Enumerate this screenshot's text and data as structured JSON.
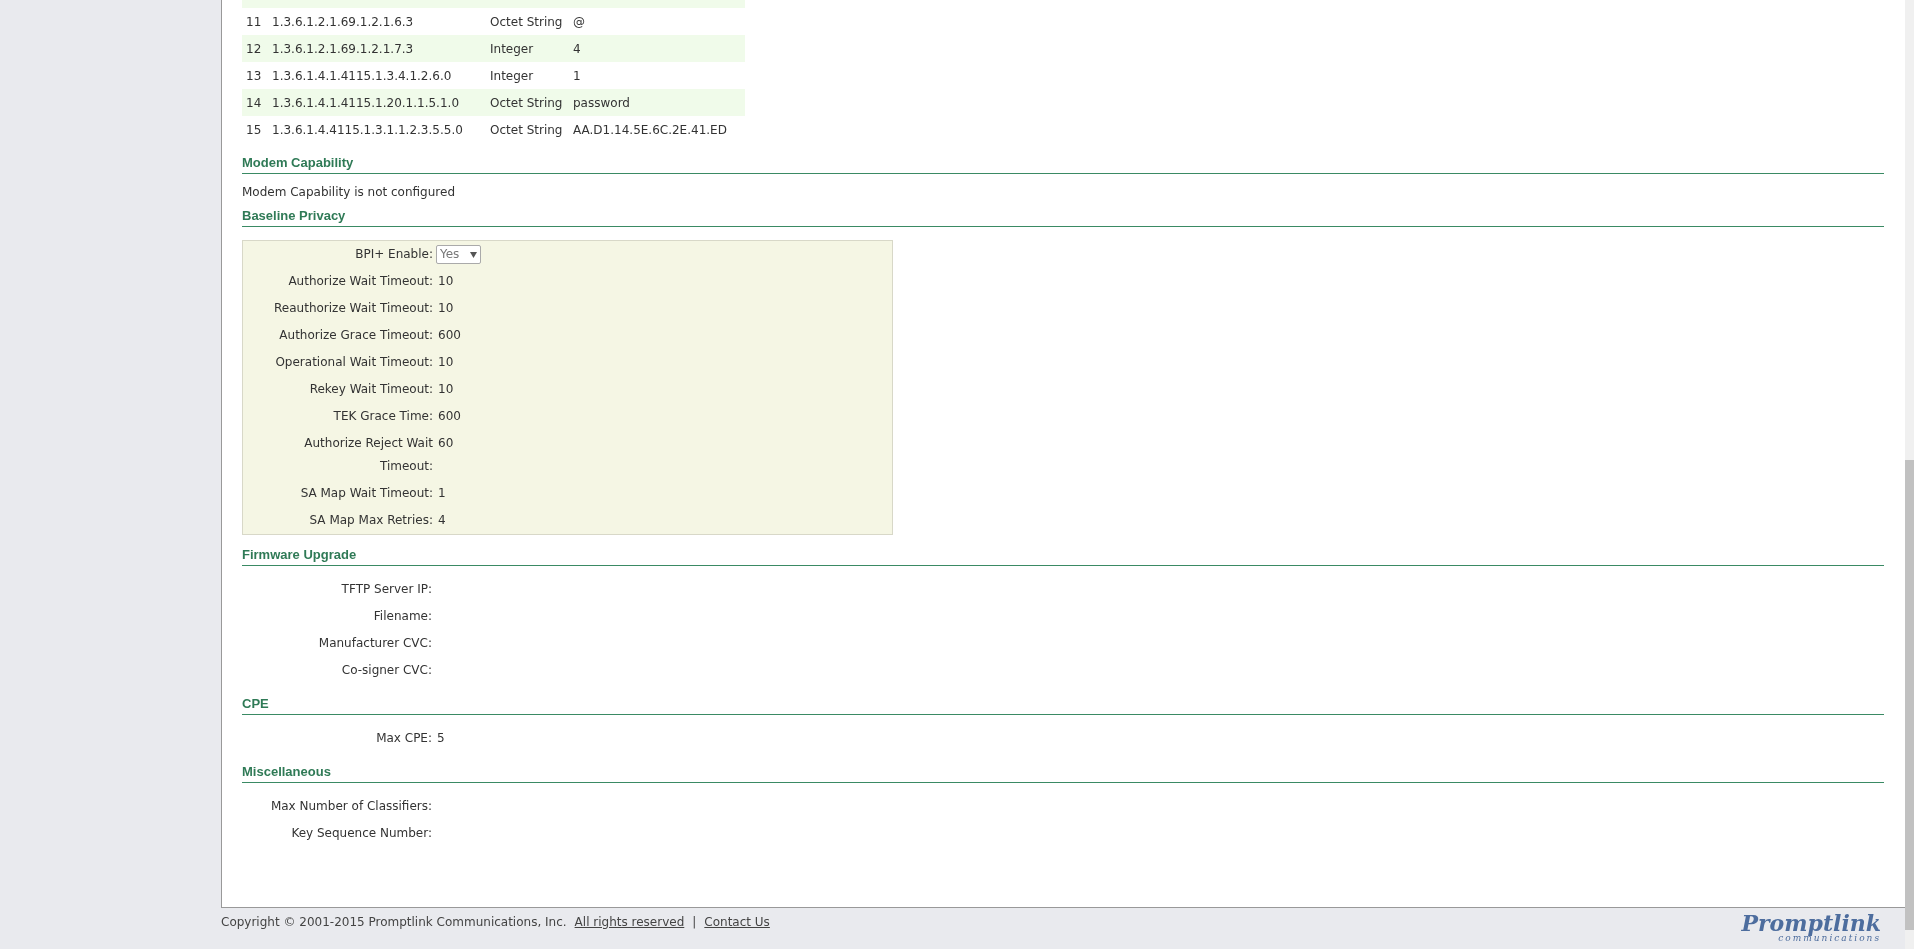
{
  "snmp_table": {
    "rows": [
      {
        "index": "11",
        "oid": "1.3.6.1.2.1.69.1.2.1.6.3",
        "type": "Octet String",
        "value": "@"
      },
      {
        "index": "12",
        "oid": "1.3.6.1.2.1.69.1.2.1.7.3",
        "type": "Integer",
        "value": "4"
      },
      {
        "index": "13",
        "oid": "1.3.6.1.4.1.4115.1.3.4.1.2.6.0",
        "type": "Integer",
        "value": "1"
      },
      {
        "index": "14",
        "oid": "1.3.6.1.4.1.4115.1.20.1.1.5.1.0",
        "type": "Octet String",
        "value": "password"
      },
      {
        "index": "15",
        "oid": "1.3.6.1.4.4115.1.3.1.1.2.3.5.5.0",
        "type": "Octet String",
        "value": "AA.D1.14.5E.6C.2E.41.ED"
      }
    ]
  },
  "sections": [
    {
      "kind": "note",
      "title": "Modem Capability",
      "text": "Modem Capability is not configured"
    },
    {
      "kind": "boxed_form",
      "title": "Baseline Privacy",
      "fields": [
        {
          "kind": "select",
          "label": "BPI+ Enable:",
          "value": "Yes"
        },
        {
          "kind": "text",
          "label": "Authorize Wait Timeout:",
          "value": "10"
        },
        {
          "kind": "text",
          "label": "Reauthorize Wait Timeout:",
          "value": "10"
        },
        {
          "kind": "text",
          "label": "Authorize Grace Timeout:",
          "value": "600"
        },
        {
          "kind": "text",
          "label": "Operational Wait Timeout:",
          "value": "10"
        },
        {
          "kind": "text",
          "label": "Rekey Wait Timeout:",
          "value": "10"
        },
        {
          "kind": "text",
          "label": "TEK Grace Time:",
          "value": "600"
        },
        {
          "kind": "text",
          "label": "Authorize Reject Wait Timeout:",
          "value": "60"
        },
        {
          "kind": "text",
          "label": "SA Map Wait Timeout:",
          "value": "1"
        },
        {
          "kind": "text",
          "label": "SA Map Max Retries:",
          "value": "4"
        }
      ]
    },
    {
      "kind": "form",
      "title": "Firmware Upgrade",
      "fields": [
        {
          "kind": "text",
          "label": "TFTP Server IP:"
        },
        {
          "kind": "text",
          "label": "Filename:"
        },
        {
          "kind": "text",
          "label": "Manufacturer CVC:"
        },
        {
          "kind": "text",
          "label": "Co-signer CVC:"
        }
      ]
    },
    {
      "kind": "form",
      "title": "CPE",
      "fields": [
        {
          "kind": "text",
          "label": "Max CPE:",
          "value": "5"
        }
      ]
    },
    {
      "kind": "form",
      "title": "Miscellaneous",
      "fields": [
        {
          "kind": "text",
          "label": "Max Number of Classifiers:"
        },
        {
          "kind": "text",
          "label": "Key Sequence Number:"
        }
      ]
    }
  ],
  "footer": {
    "copyright": "Copyright © 2001-2015 Promptlink Communications, Inc.",
    "links": [
      "All rights reserved",
      "Contact Us"
    ],
    "separator": "|"
  },
  "logo": {
    "name": "Promptlink",
    "tagline": "communications"
  }
}
